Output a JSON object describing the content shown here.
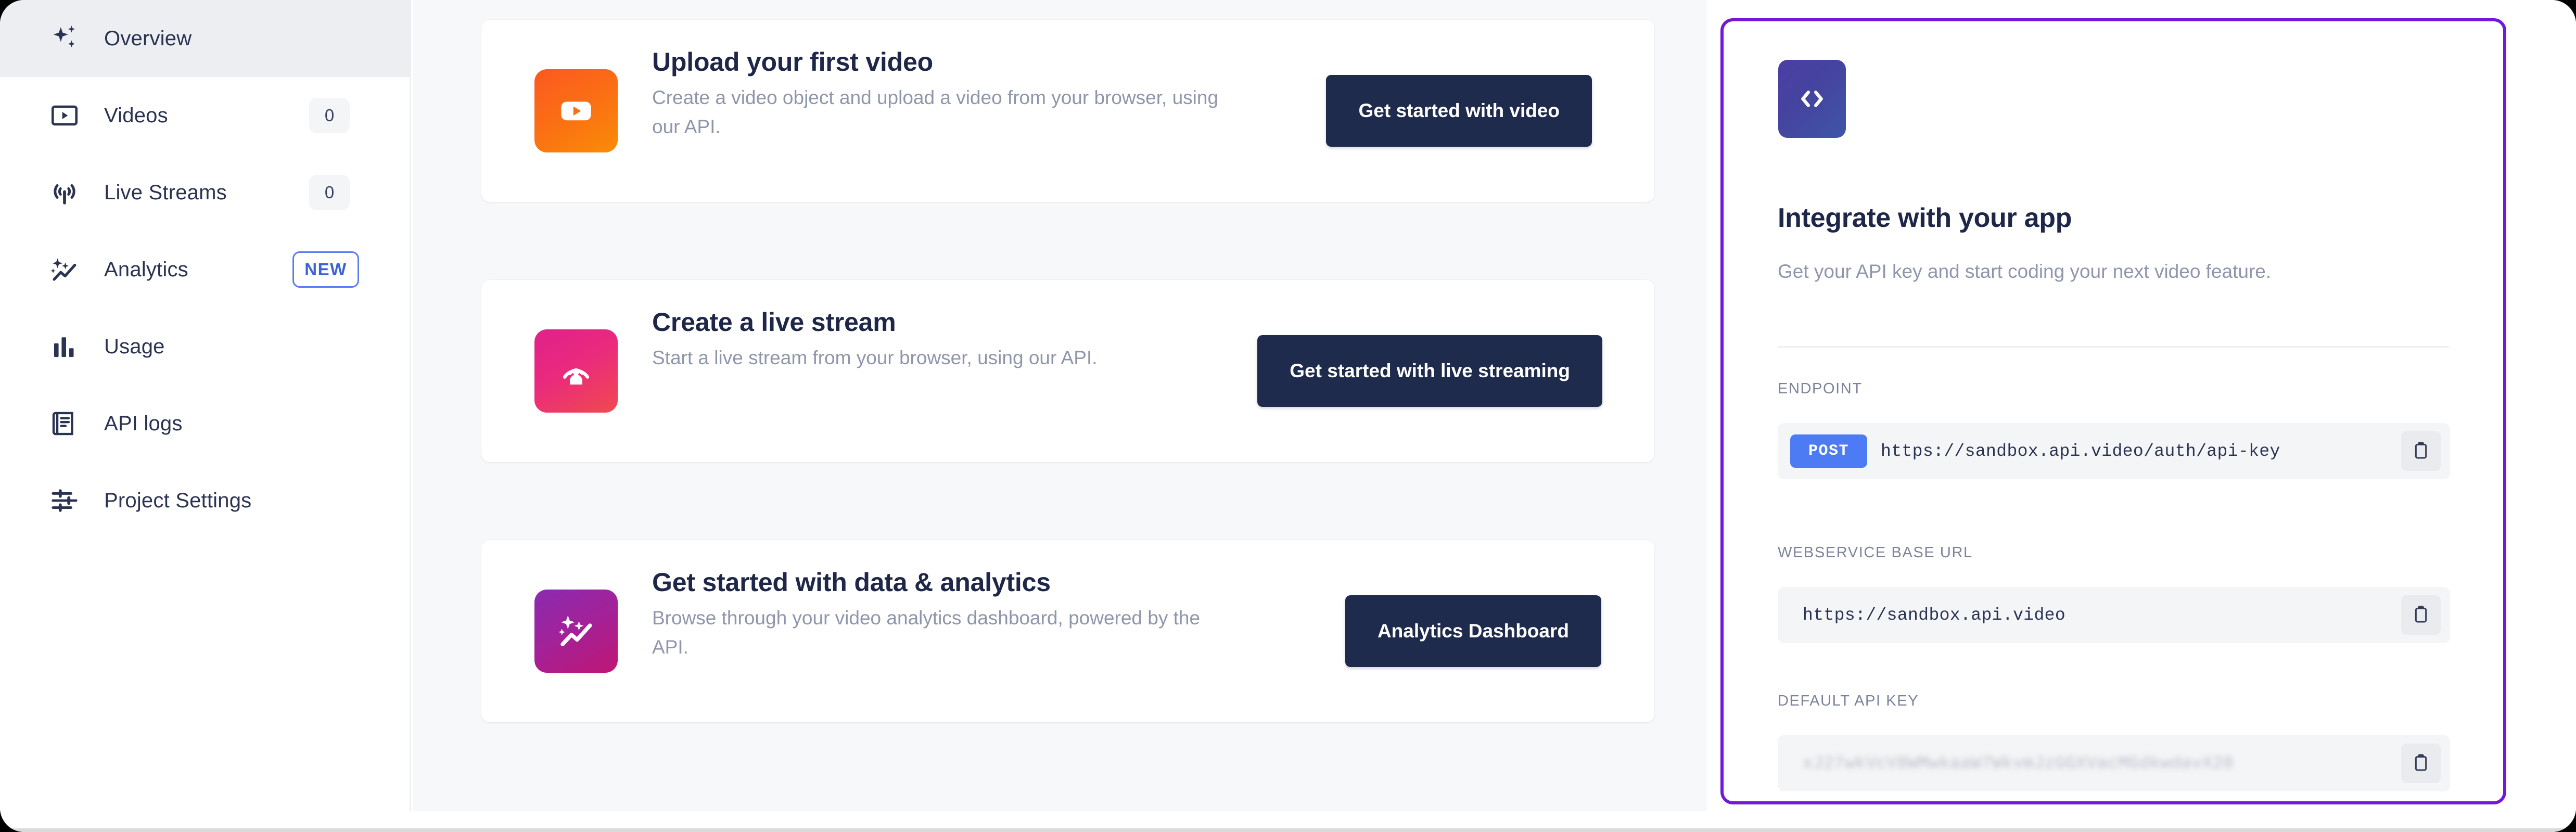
{
  "sidebar": {
    "items": [
      {
        "label": "Overview",
        "icon": "sparkles-icon",
        "badge": null,
        "badge_type": null,
        "active": true
      },
      {
        "label": "Videos",
        "icon": "video-icon",
        "badge": "0",
        "badge_type": "count",
        "active": false
      },
      {
        "label": "Live Streams",
        "icon": "broadcast-icon",
        "badge": "0",
        "badge_type": "count",
        "active": false
      },
      {
        "label": "Analytics",
        "icon": "analytics-icon",
        "badge": "NEW",
        "badge_type": "new",
        "active": false
      },
      {
        "label": "Usage",
        "icon": "bar-chart-icon",
        "badge": null,
        "badge_type": null,
        "active": false
      },
      {
        "label": "API logs",
        "icon": "logs-icon",
        "badge": null,
        "badge_type": null,
        "active": false
      },
      {
        "label": "Project Settings",
        "icon": "sliders-icon",
        "badge": null,
        "badge_type": null,
        "active": false
      }
    ]
  },
  "main": {
    "cards": [
      {
        "title": "Upload your first video",
        "description": "Create a video object and upload a video from your browser, using our API.",
        "button_label": "Get started with video",
        "icon": "video-play-icon",
        "icon_color": "#fb6f14"
      },
      {
        "title": "Create a live stream",
        "description": "Start a live stream from your browser, using our API.",
        "button_label": "Get started with live streaming",
        "icon": "live-broadcast-icon",
        "icon_color": "#ea2a7d"
      },
      {
        "title": "Get started with data & analytics",
        "description": "Browse through your video analytics dashboard, powered by the API.",
        "button_label": "Analytics Dashboard",
        "icon": "analytics-sparkle-icon",
        "icon_color": "#a42197"
      }
    ]
  },
  "integrate": {
    "icon": "code-brackets-icon",
    "title": "Integrate with your app",
    "subtitle": "Get your API key and start coding your next video feature.",
    "border_color": "#7317d8",
    "fields": [
      {
        "label": "ENDPOINT",
        "method": "POST",
        "value": "https://sandbox.api.video/auth/api-key",
        "masked": false,
        "copy_icon": "clipboard-icon"
      },
      {
        "label": "WEBSERVICE BASE URL",
        "method": null,
        "value": "https://sandbox.api.video",
        "masked": false,
        "copy_icon": "clipboard-icon"
      },
      {
        "label": "DEFAULT API KEY",
        "method": null,
        "value": "xJ27wkVcV8WMwkaaW7WkvmJzGGXVacMGdkwdavX28",
        "masked": true,
        "copy_icon": "clipboard-icon"
      }
    ]
  }
}
